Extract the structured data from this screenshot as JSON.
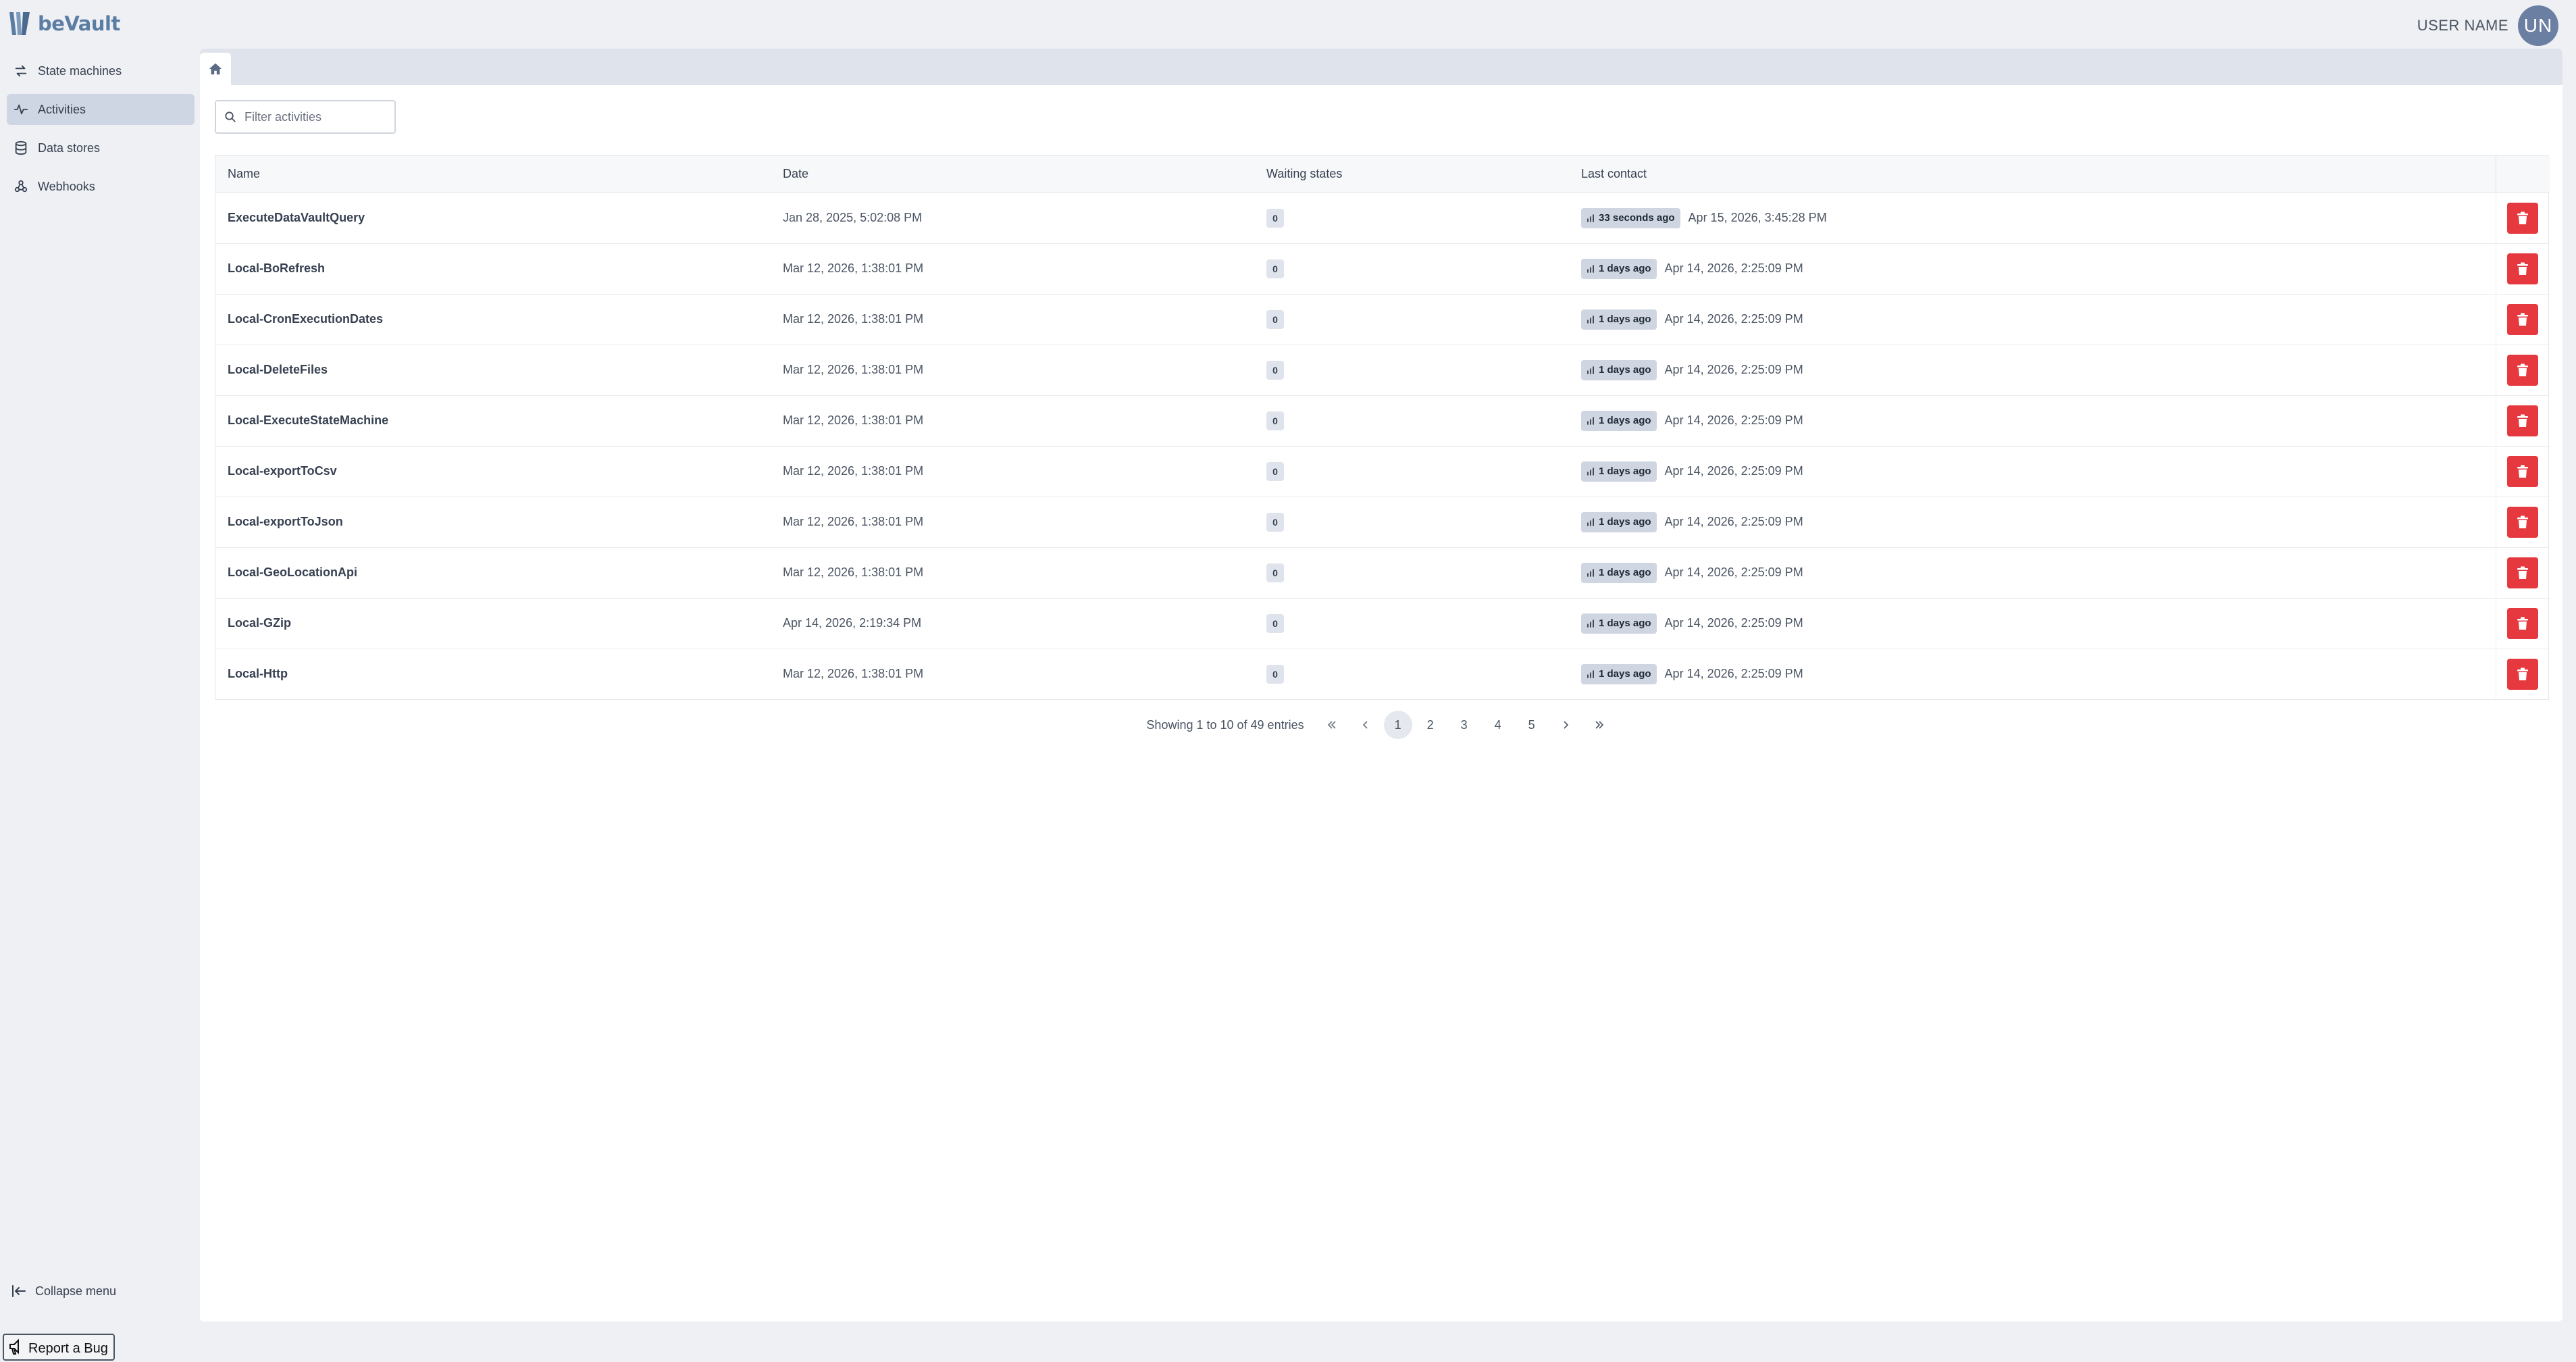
{
  "app": {
    "name": "beVault",
    "user_name": "USER NAME",
    "user_initials": "UN"
  },
  "sidebar": {
    "items": [
      {
        "label": "State machines",
        "icon": "arrows-exchange-icon",
        "active": false
      },
      {
        "label": "Activities",
        "icon": "activity-pulse-icon",
        "active": true
      },
      {
        "label": "Data stores",
        "icon": "database-icon",
        "active": false
      },
      {
        "label": "Webhooks",
        "icon": "webhook-icon",
        "active": false
      }
    ],
    "collapse_label": "Collapse menu",
    "report_bug_label": "Report a Bug"
  },
  "filter": {
    "placeholder": "Filter activities",
    "value": ""
  },
  "table": {
    "headers": {
      "name": "Name",
      "date": "Date",
      "waiting": "Waiting states",
      "last_contact": "Last contact"
    },
    "rows": [
      {
        "name": "ExecuteDataVaultQuery",
        "date": "Jan 28, 2025, 5:02:08 PM",
        "waiting": "0",
        "ago": "33 seconds ago",
        "contact": "Apr 15, 2026, 3:45:28 PM"
      },
      {
        "name": "Local-BoRefresh",
        "date": "Mar 12, 2026, 1:38:01 PM",
        "waiting": "0",
        "ago": "1 days ago",
        "contact": "Apr 14, 2026, 2:25:09 PM"
      },
      {
        "name": "Local-CronExecutionDates",
        "date": "Mar 12, 2026, 1:38:01 PM",
        "waiting": "0",
        "ago": "1 days ago",
        "contact": "Apr 14, 2026, 2:25:09 PM"
      },
      {
        "name": "Local-DeleteFiles",
        "date": "Mar 12, 2026, 1:38:01 PM",
        "waiting": "0",
        "ago": "1 days ago",
        "contact": "Apr 14, 2026, 2:25:09 PM"
      },
      {
        "name": "Local-ExecuteStateMachine",
        "date": "Mar 12, 2026, 1:38:01 PM",
        "waiting": "0",
        "ago": "1 days ago",
        "contact": "Apr 14, 2026, 2:25:09 PM"
      },
      {
        "name": "Local-exportToCsv",
        "date": "Mar 12, 2026, 1:38:01 PM",
        "waiting": "0",
        "ago": "1 days ago",
        "contact": "Apr 14, 2026, 2:25:09 PM"
      },
      {
        "name": "Local-exportToJson",
        "date": "Mar 12, 2026, 1:38:01 PM",
        "waiting": "0",
        "ago": "1 days ago",
        "contact": "Apr 14, 2026, 2:25:09 PM"
      },
      {
        "name": "Local-GeoLocationApi",
        "date": "Mar 12, 2026, 1:38:01 PM",
        "waiting": "0",
        "ago": "1 days ago",
        "contact": "Apr 14, 2026, 2:25:09 PM"
      },
      {
        "name": "Local-GZip",
        "date": "Apr 14, 2026, 2:19:34 PM",
        "waiting": "0",
        "ago": "1 days ago",
        "contact": "Apr 14, 2026, 2:25:09 PM"
      },
      {
        "name": "Local-Http",
        "date": "Mar 12, 2026, 1:38:01 PM",
        "waiting": "0",
        "ago": "1 days ago",
        "contact": "Apr 14, 2026, 2:25:09 PM"
      }
    ]
  },
  "pagination": {
    "info": "Showing 1 to 10 of 49 entries",
    "pages": [
      "1",
      "2",
      "3",
      "4",
      "5"
    ],
    "current": "1"
  },
  "colors": {
    "accent": "#5b7da3",
    "danger": "#e5393f",
    "active_nav": "#cfd6e3",
    "badge": "#cfd6e2",
    "background": "#eef0f4"
  }
}
